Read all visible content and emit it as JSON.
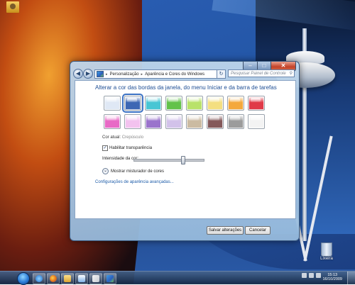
{
  "desktop": {
    "icons": [
      {
        "name": "user-folder",
        "label": ""
      },
      {
        "name": "recycle-bin",
        "label": "Lixeira"
      }
    ]
  },
  "window": {
    "controls": {
      "minimize": "–",
      "maximize": "□",
      "close": "✕"
    },
    "nav": {
      "back": "◀",
      "forward": "▶",
      "refresh": "↻"
    },
    "breadcrumb": [
      "Personalização",
      "Aparência e Cores do Windows"
    ],
    "search_placeholder": "Pesquisar Painel de Controle",
    "heading": "Alterar a cor das bordas da janela, do menu Iniciar e da barra de tarefas",
    "swatches": [
      {
        "name": "sky",
        "color": "#dfe8f5",
        "selected": false
      },
      {
        "name": "twilight",
        "color": "#3d67b4",
        "selected": true
      },
      {
        "name": "sea",
        "color": "#48c6d4",
        "selected": false
      },
      {
        "name": "leaf",
        "color": "#62c24a",
        "selected": false
      },
      {
        "name": "lime",
        "color": "#b9e26a",
        "selected": false
      },
      {
        "name": "pumpkin-light",
        "color": "#f4df80",
        "selected": false
      },
      {
        "name": "pumpkin",
        "color": "#f4a83c",
        "selected": false
      },
      {
        "name": "ruby",
        "color": "#e03a48",
        "selected": false
      },
      {
        "name": "fuchsia",
        "color": "#e86ac6",
        "selected": false
      },
      {
        "name": "blush",
        "color": "#f3c2ef",
        "selected": false
      },
      {
        "name": "violet",
        "color": "#9a74cc",
        "selected": false
      },
      {
        "name": "lavender",
        "color": "#d2c2ea",
        "selected": false
      },
      {
        "name": "taupe",
        "color": "#cbbba2",
        "selected": false
      },
      {
        "name": "chocolate",
        "color": "#84585a",
        "selected": false
      },
      {
        "name": "slate",
        "color": "#9c9c9c",
        "selected": false
      },
      {
        "name": "frost",
        "color": "#f3f3f3",
        "selected": false
      }
    ],
    "current_color_label": "Cor atual:",
    "current_color_value": "Crepúsculo",
    "transparency_label": "Habilitar transparência",
    "transparency_checked": "✓",
    "intensity_label": "Intensidade da cor:",
    "intensity_value": 0.7,
    "mixer_label": "Mostrar misturador de cores",
    "mixer_icon": "⌄",
    "advanced_link": "Configurações de aparência avançadas...",
    "save_button": "Salvar alterações",
    "cancel_button": "Cancelar"
  },
  "taskbar": {
    "items": [
      "internet-explorer",
      "firefox",
      "explorer",
      "media-player",
      "paint",
      "control-panel"
    ],
    "clock_time": "15:13",
    "clock_date": "16/10/2009"
  }
}
